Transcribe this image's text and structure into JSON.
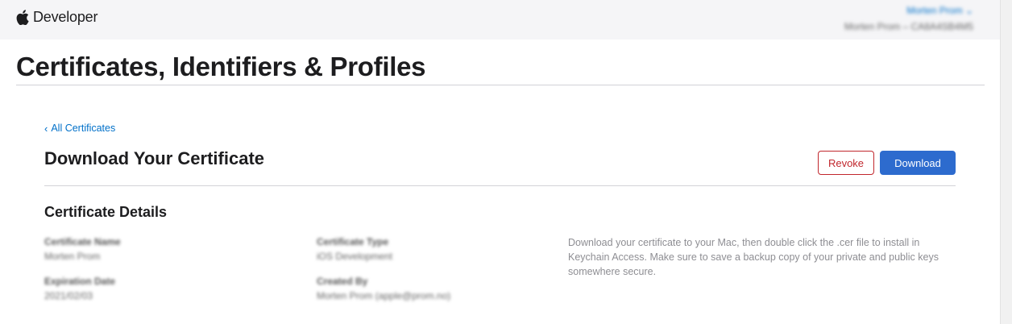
{
  "header": {
    "brand": "Developer",
    "account_name": "Morten Prom",
    "account_chevron": "⌄",
    "account_team": "Morten Prom – CA8A4SB4M5"
  },
  "page": {
    "title": "Certificates, Identifiers & Profiles"
  },
  "certificate": {
    "back_link": "All Certificates",
    "heading": "Download Your Certificate",
    "revoke_label": "Revoke",
    "download_label": "Download",
    "details_heading": "Certificate Details",
    "fields": {
      "name_label": "Certificate Name",
      "name_value": "Morten Prom",
      "type_label": "Certificate Type",
      "type_value": "iOS Development",
      "expiration_label": "Expiration Date",
      "expiration_value": "2021/02/03",
      "created_label": "Created By",
      "created_value": "Morten Prom (apple@prom.no)"
    },
    "instructions": "Download your certificate to your Mac, then double click the .cer file to install in Keychain Access. Make sure to save a backup copy of your private and public keys somewhere secure."
  },
  "colors": {
    "link": "#0070c9",
    "revoke": "#c1272d",
    "download": "#2d6bce"
  },
  "icons": {
    "logo": "apple-logo-icon",
    "back": "chevron-left-icon"
  }
}
